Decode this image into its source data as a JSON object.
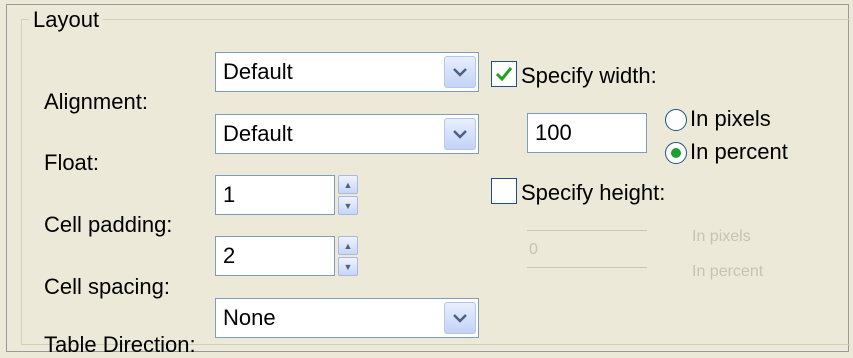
{
  "section_title": "Layout",
  "alignment": {
    "label": "Alignment:",
    "value": "Default"
  },
  "float": {
    "label": "Float:",
    "value": "Default"
  },
  "cell_padding": {
    "label": "Cell padding:",
    "value": "1"
  },
  "cell_spacing": {
    "label": "Cell spacing:",
    "value": "2"
  },
  "table_direction": {
    "label": "Table Direction:",
    "value": "None"
  },
  "specify_width": {
    "label": "Specify width:",
    "checked": true,
    "value": "100"
  },
  "width_units": {
    "pixels_label": "In pixels",
    "percent_label": "In percent",
    "selected": "percent"
  },
  "specify_height": {
    "label": "Specify height:",
    "checked": false,
    "value": "0"
  },
  "height_units": {
    "pixels_label": "In pixels",
    "percent_label": "In percent"
  },
  "colors": {
    "input_border": "#7f9db9",
    "dialog_bg": "#ece9d8",
    "check_green": "#21a121"
  }
}
